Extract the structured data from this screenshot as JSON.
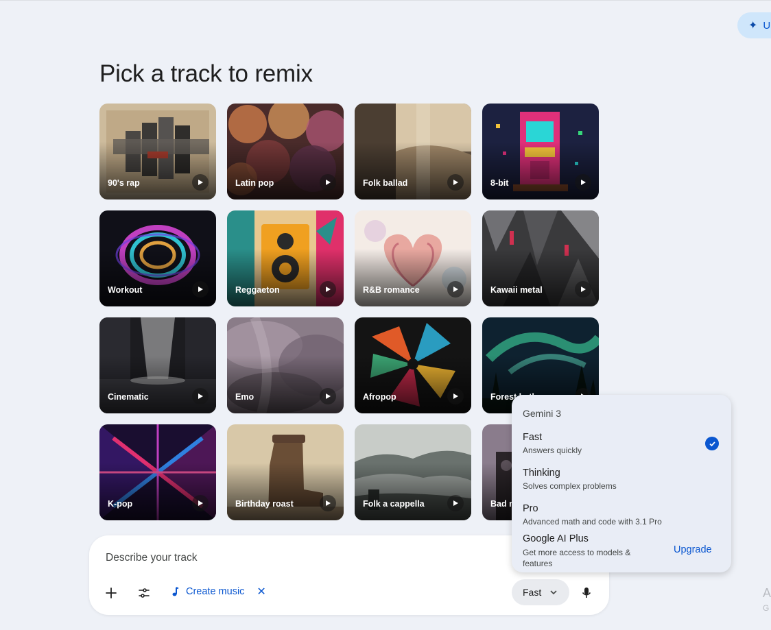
{
  "header": {
    "upgrade_label": "U"
  },
  "page": {
    "title": "Pick a track to remix"
  },
  "tracks": [
    {
      "label": "90's rap"
    },
    {
      "label": "Latin pop"
    },
    {
      "label": "Folk ballad"
    },
    {
      "label": "8-bit"
    },
    {
      "label": "Workout"
    },
    {
      "label": "Reggaeton"
    },
    {
      "label": "R&B romance"
    },
    {
      "label": "Kawaii metal"
    },
    {
      "label": "Cinematic"
    },
    {
      "label": "Emo"
    },
    {
      "label": "Afropop"
    },
    {
      "label": "Forest bath"
    },
    {
      "label": "K-pop"
    },
    {
      "label": "Birthday roast"
    },
    {
      "label": "Folk a cappella"
    },
    {
      "label": "Bad m"
    }
  ],
  "composer": {
    "prompt": "Describe your track",
    "chip_label": "Create music",
    "mode_label": "Fast"
  },
  "menu": {
    "header": "Gemini 3",
    "options": [
      {
        "title": "Fast",
        "subtitle": "Answers quickly",
        "selected": true
      },
      {
        "title": "Thinking",
        "subtitle": "Solves complex problems",
        "selected": false
      },
      {
        "title": "Pro",
        "subtitle": "Advanced math and code with 3.1 Pro",
        "selected": false
      },
      {
        "title": "Google AI Plus",
        "subtitle": "Get more access to models & features",
        "selected": false
      }
    ],
    "upgrade_link": "Upgrade"
  },
  "edge": {
    "a": "A",
    "g": "G"
  },
  "colors": {
    "accent": "#0b57d0",
    "background": "#eef1f7"
  }
}
